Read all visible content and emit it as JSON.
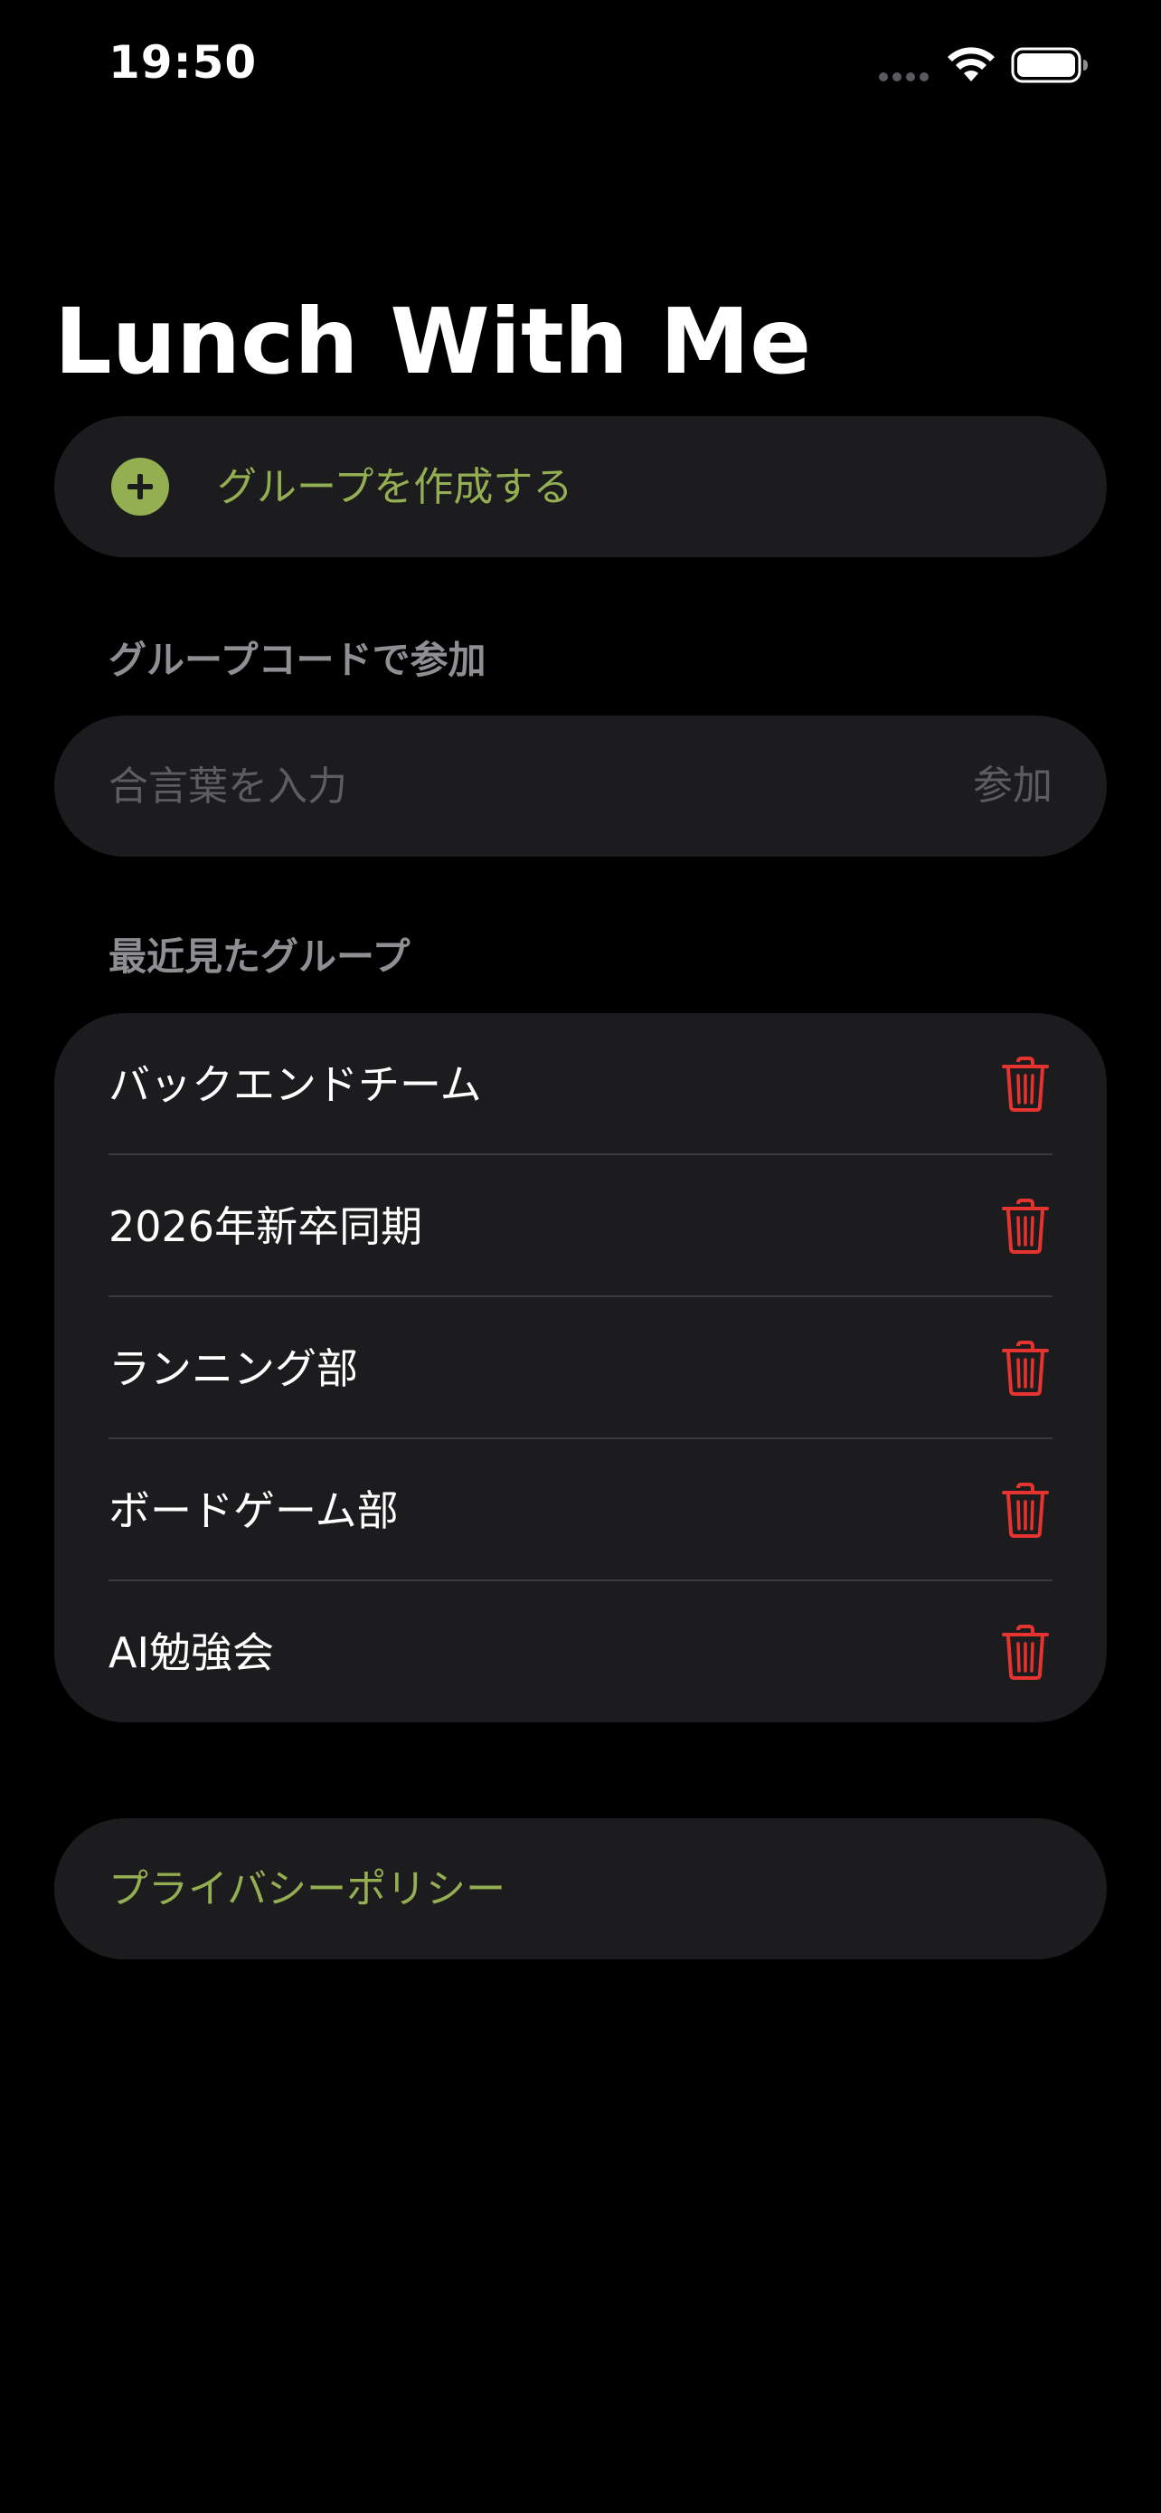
{
  "status_bar": {
    "time": "19:50"
  },
  "app": {
    "title": "Lunch With Me"
  },
  "create_group": {
    "label": "グループを作成する",
    "icon": "plus-circle-icon"
  },
  "join_section": {
    "header": "グループコードで参加",
    "input_placeholder": "合言葉を入力",
    "input_value": "",
    "button_label": "参加"
  },
  "recent_section": {
    "header": "最近見たグループ",
    "groups": [
      {
        "name": "バックエンドチーム"
      },
      {
        "name": "2026年新卒同期"
      },
      {
        "name": "ランニング部"
      },
      {
        "name": "ボードゲーム部"
      },
      {
        "name": "AI勉強会"
      }
    ],
    "delete_icon": "trash-icon"
  },
  "privacy": {
    "label": "プライバシーポリシー"
  },
  "colors": {
    "background": "#000000",
    "card": "#1c1c1e",
    "accent": "#94ae52",
    "secondary_text": "#8e8e93",
    "placeholder": "#5c5c61",
    "destructive": "#e5342f",
    "separator": "#3a3a3c"
  }
}
